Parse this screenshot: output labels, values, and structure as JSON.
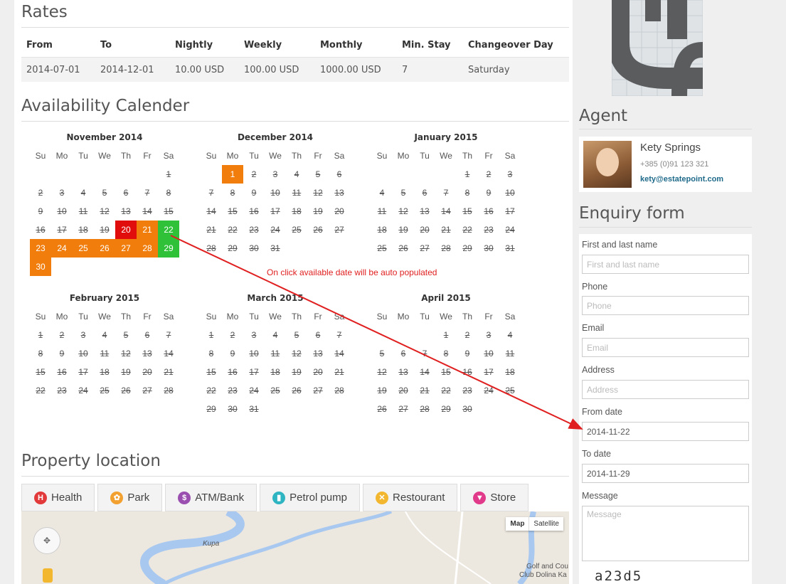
{
  "rates": {
    "title": "Rates",
    "headers": [
      "From",
      "To",
      "Nightly",
      "Weekly",
      "Monthly",
      "Min. Stay",
      "Changeover Day"
    ],
    "row": [
      "2014-07-01",
      "2014-12-01",
      "10.00 USD",
      "100.00 USD",
      "1000.00 USD",
      "7",
      "Saturday"
    ]
  },
  "calendar": {
    "title": "Availability Calender",
    "dow": [
      "Su",
      "Mo",
      "Tu",
      "We",
      "Th",
      "Fr",
      "Sa"
    ],
    "hint": "On click available date will be auto populated",
    "months": [
      {
        "name": "November 2014",
        "start": 6,
        "days": 30,
        "past_until": 19,
        "red": [
          20
        ],
        "orange": [
          21,
          23,
          24,
          25,
          26,
          27,
          28,
          30
        ],
        "green": [
          22,
          29
        ]
      },
      {
        "name": "December 2014",
        "start": 1,
        "days": 31,
        "past_until": 0,
        "orange": [
          1
        ],
        "past_list": [
          2,
          3,
          4,
          5,
          6,
          7,
          8,
          9,
          10,
          11,
          12,
          13,
          14,
          15,
          16,
          17,
          18,
          19,
          20,
          21,
          22,
          23,
          24,
          25,
          26,
          27,
          28,
          29,
          30,
          31
        ]
      },
      {
        "name": "January 2015",
        "start": 4,
        "days": 31,
        "past_until": 31
      },
      {
        "name": "February 2015",
        "start": 0,
        "days": 28,
        "past_until": 28
      },
      {
        "name": "March 2015",
        "start": 0,
        "days": 31,
        "past_until": 31
      },
      {
        "name": "April 2015",
        "start": 3,
        "days": 30,
        "past_until": 30
      }
    ]
  },
  "location": {
    "title": "Property location",
    "tabs": [
      {
        "label": "Health",
        "icon": "health-icon",
        "color": "#e23a3a",
        "glyph": "H"
      },
      {
        "label": "Park",
        "icon": "park-icon",
        "color": "#f2a02f",
        "glyph": "✿"
      },
      {
        "label": "ATM/Bank",
        "icon": "atm-icon",
        "color": "#9a4fb0",
        "glyph": "$"
      },
      {
        "label": "Petrol pump",
        "icon": "petrol-icon",
        "color": "#2fb4c2",
        "glyph": "⛽"
      },
      {
        "label": "Restourant",
        "icon": "restaurant-icon",
        "color": "#f2b72f",
        "glyph": "✕"
      },
      {
        "label": "Store",
        "icon": "store-icon",
        "color": "#e23a8a",
        "glyph": "▼"
      }
    ],
    "map_type": [
      "Map",
      "Satellite"
    ],
    "labels": [
      "Kupa",
      "Golf and Cou",
      "Club Dolina Ka"
    ]
  },
  "agent": {
    "title": "Agent",
    "name": "Kety Springs",
    "phone": "+385 (0)91 123 321",
    "email": "kety@estatepoint.com"
  },
  "enquiry": {
    "title": "Enquiry form",
    "name_label": "First and last name",
    "name_placeholder": "First and last name",
    "phone_label": "Phone",
    "phone_placeholder": "Phone",
    "email_label": "Email",
    "email_placeholder": "Email",
    "address_label": "Address",
    "address_placeholder": "Address",
    "from_label": "From date",
    "from_value": "2014-11-22",
    "to_label": "To date",
    "to_value": "2014-11-29",
    "message_label": "Message",
    "message_placeholder": "Message",
    "captcha": "a23d5"
  },
  "colors": {
    "booked": "#f07d0c",
    "selected_start": "#e10d0d",
    "available_pick": "#2fc138",
    "annotation": "#e02020"
  }
}
